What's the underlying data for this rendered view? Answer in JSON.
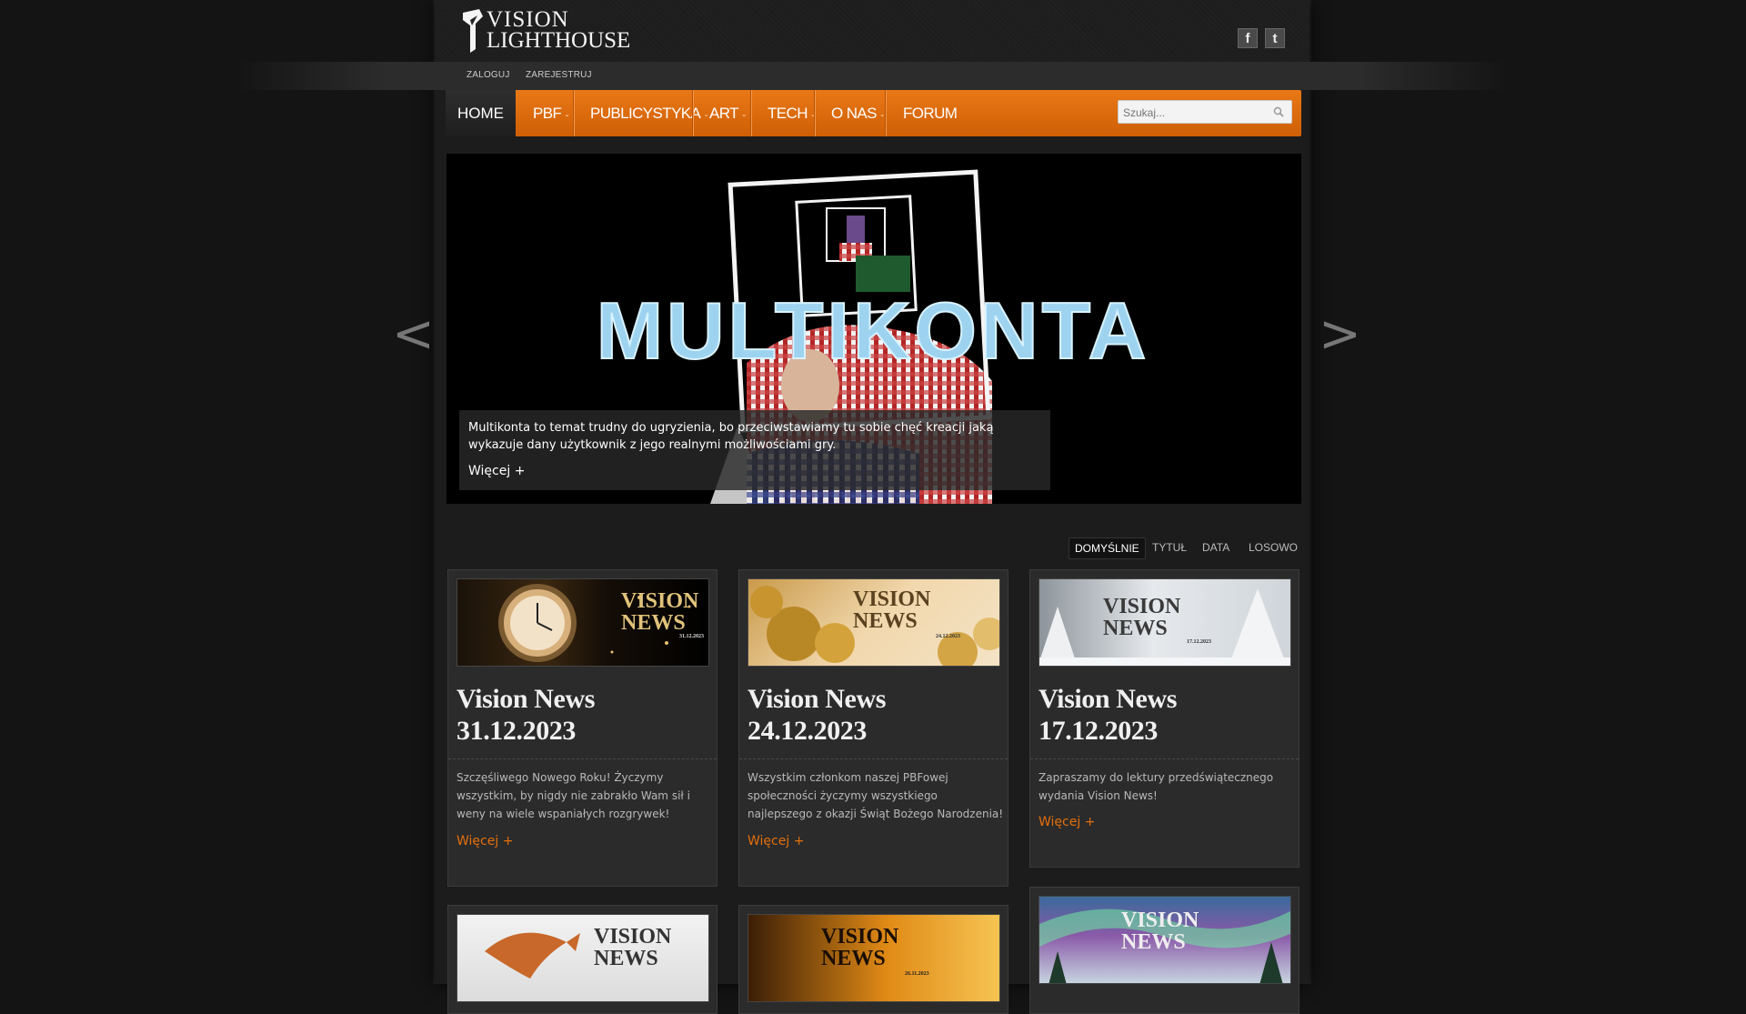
{
  "site": {
    "logo_line1": "VISION",
    "logo_line2": "LIGHTHOUSE"
  },
  "header": {
    "facebook_icon": "f",
    "twitter_icon": "t"
  },
  "auth": {
    "login": "ZALOGUJ",
    "register": "ZAREJESTRUJ"
  },
  "nav": {
    "items": [
      {
        "label": "HOME",
        "dropdown": false
      },
      {
        "label": "PBF",
        "dropdown": true
      },
      {
        "label": "PUBLICYSTYKA",
        "dropdown": true
      },
      {
        "label": "ART",
        "dropdown": true
      },
      {
        "label": "TECH",
        "dropdown": true
      },
      {
        "label": "O NAS",
        "dropdown": true
      },
      {
        "label": "FORUM",
        "dropdown": false
      }
    ],
    "search_placeholder": "Szukaj..."
  },
  "slider": {
    "headline": "MULTIKONTA",
    "caption": "Multikonta to temat trudny do ugryzienia, bo przeciwstawiamy tu sobie chęć kreacji jaką wykazuje dany użytkownik z jego realnymi możliwościami gry.",
    "more": "Więcej +",
    "prev": "<",
    "next": ">"
  },
  "sort": {
    "default": "DOMYŚLNIE",
    "title": "TYTUŁ",
    "date": "DATA",
    "random": "LOSOWO"
  },
  "cards": [
    {
      "title": "Vision News 31.12.2023",
      "image_logo": "VISION NEWS",
      "image_date": "31.12.2023",
      "excerpt": "Szczęśliwego Nowego Roku! Życzymy wszystkim, by nigdy nie zabrakło Wam sił i weny na wiele wspaniałych rozgrywek!",
      "more": "Więcej +"
    },
    {
      "title": "Vision News 24.12.2023",
      "image_logo": "VISION NEWS",
      "image_date": "24.12.2023",
      "excerpt": "Wszystkim członkom naszej PBFowej społeczności życzymy wszystkiego najlepszego z okazji Świąt Bożego Narodzenia!",
      "more": "Więcej +"
    },
    {
      "title": "Vision News 17.12.2023",
      "image_logo": "VISION NEWS",
      "image_date": "17.12.2023",
      "excerpt": "Zapraszamy do lektury przedświątecznego wydania Vision News!",
      "more": "Więcej +"
    }
  ],
  "cards_row2": [
    {
      "image_logo": "VISION NEWS"
    },
    {
      "image_logo": "VISION NEWS",
      "image_date": "26.11.2023"
    },
    {
      "image_logo": "VISION NEWS"
    }
  ]
}
